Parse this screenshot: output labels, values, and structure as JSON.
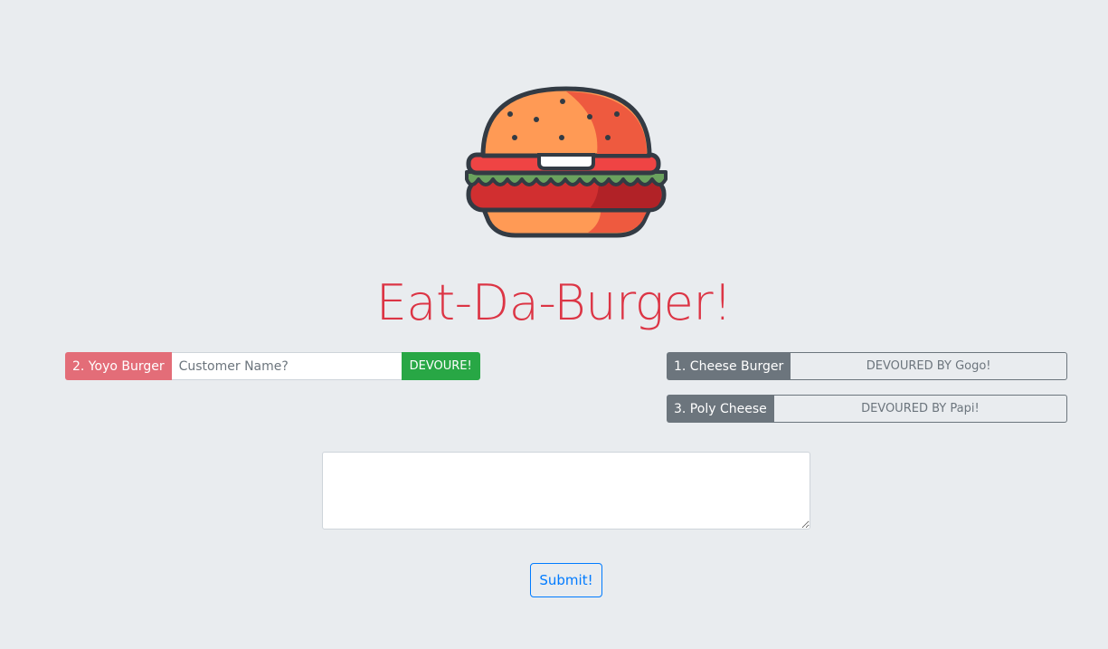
{
  "header": {
    "title": "Eat-Da-Burger!"
  },
  "undevoured": [
    {
      "label": "2. Yoyo Burger",
      "input_placeholder": "Customer Name?",
      "button_label": "DEVOURE!"
    }
  ],
  "devoured": [
    {
      "label": "1. Cheese Burger",
      "status": "DEVOURED BY Gogo!"
    },
    {
      "label": "3. Poly Cheese",
      "status": "DEVOURED BY Papi!"
    }
  ],
  "form": {
    "textarea_value": "",
    "submit_label": "Submit!"
  },
  "colors": {
    "background": "#e9ecef",
    "title": "#dc3545",
    "pending_badge": "#e36d78",
    "devoured_badge": "#6c757d",
    "devour_button": "#28a745",
    "submit_button": "#007bff"
  }
}
